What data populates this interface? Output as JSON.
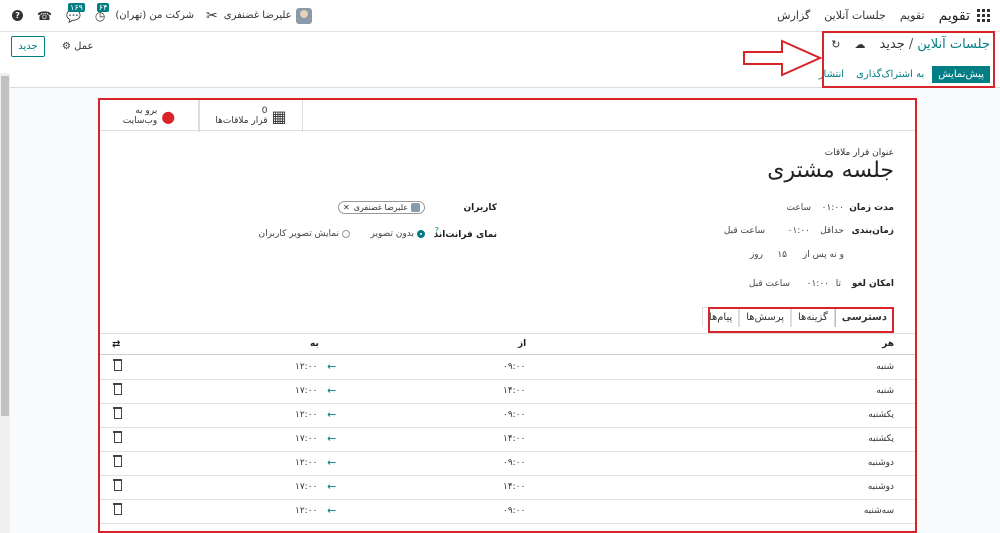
{
  "nav": {
    "brand": "تقویم",
    "menu": [
      "تقویم",
      "جلسات آنلاین",
      "گزارش"
    ],
    "user_name": "علیرضا غضنفری",
    "company": "شرکت من (تهران)",
    "activity_badge": "۶۴",
    "messages_badge": "۱۶۹",
    "help_icon": "?"
  },
  "control": {
    "new_button": "جدید",
    "action_label": "عمل",
    "breadcrumb_parent": "جلسات آنلاین",
    "breadcrumb_sep": "/",
    "breadcrumb_current": "جدید",
    "preview": "پیش‌نمایش",
    "share": "به اشتراک‌گذاری",
    "publish": "انتشار"
  },
  "smart_buttons": {
    "meetings_count": "0",
    "meetings_label": "قرار ملاقات‌ها",
    "website_line1": "برو به",
    "website_line2": "وب‌سایت"
  },
  "form": {
    "title_caption": "عنوان قرار ملاقات",
    "title": "جلسه مشتری",
    "duration_label": "مدت زمان",
    "duration_value": "۰۱:۰۰",
    "duration_unit": "ساعت",
    "scheduling_label": "زمان‌بندی",
    "scheduling_min": "حداقل",
    "scheduling_min_value": "۰۱:۰۰",
    "scheduling_min_unit": "ساعت قبل",
    "scheduling_max_prefix": "و نه پس از",
    "scheduling_max_value": "۱۵",
    "scheduling_max_unit": "روز",
    "cancel_label": "امکان لغو",
    "cancel_prefix": "تا",
    "cancel_value": "۰۱:۰۰",
    "cancel_unit": "ساعت قبل",
    "users_label": "کاربران",
    "user_tag": "علیرضا غضنفری",
    "frontend_label": "نمای فرانت‌اند",
    "frontend_help": "?",
    "frontend_opt1": "بدون تصویر",
    "frontend_opt2": "نمایش تصویر کاربران"
  },
  "tabs": [
    "دسترسی",
    "گزینه‌ها",
    "پرسش‌ها",
    "پیام‌ها"
  ],
  "table": {
    "headers": {
      "day": "هر",
      "from": "از",
      "to": "به"
    },
    "rows": [
      {
        "day": "شنبه",
        "from": "۰۹:۰۰",
        "to": "۱۲:۰۰"
      },
      {
        "day": "شنبه",
        "from": "۱۴:۰۰",
        "to": "۱۷:۰۰"
      },
      {
        "day": "یکشنبه",
        "from": "۰۹:۰۰",
        "to": "۱۲:۰۰"
      },
      {
        "day": "یکشنبه",
        "from": "۱۴:۰۰",
        "to": "۱۷:۰۰"
      },
      {
        "day": "دوشنبه",
        "from": "۰۹:۰۰",
        "to": "۱۲:۰۰"
      },
      {
        "day": "دوشنبه",
        "from": "۱۴:۰۰",
        "to": "۱۷:۰۰"
      },
      {
        "day": "سه‌شنبه",
        "from": "۰۹:۰۰",
        "to": "۱۲:۰۰"
      }
    ]
  },
  "colors": {
    "accent": "#017e84",
    "annotation": "#d8232a"
  }
}
